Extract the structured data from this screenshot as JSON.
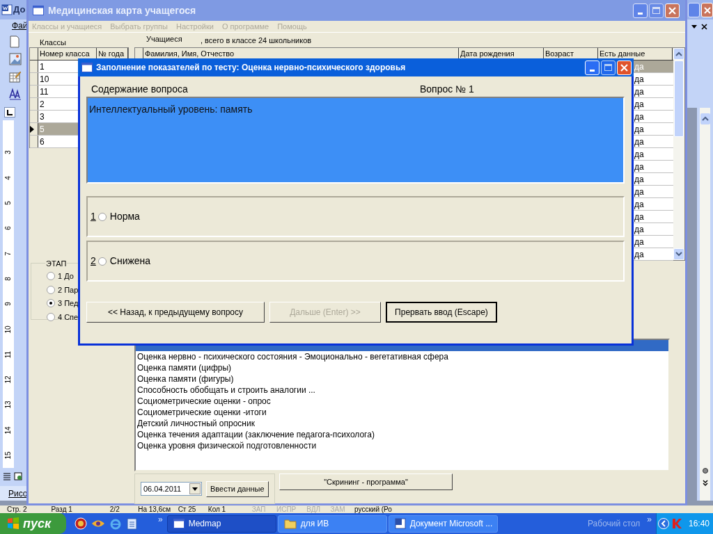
{
  "word_window": {
    "title": "До",
    "menu_item": "Фай",
    "ruler_numbers": [
      "3",
      "4",
      "5",
      "6",
      "7",
      "8",
      "9",
      "10",
      "11",
      "12",
      "13",
      "14",
      "15"
    ],
    "drawing_toolbar": "Рисо",
    "status_bar": [
      "Стр. 2",
      "Разд 1",
      "2/2",
      "На 13,6см",
      "Ст 25",
      "Кол 1",
      "ЗАП",
      "ИСПР",
      "ВДЛ",
      "ЗАМ",
      "русский (Ро"
    ]
  },
  "main_window": {
    "title": "Медицинская карта учащегося",
    "menu": [
      {
        "label": "Классы и учащиеся",
        "disabled": true
      },
      {
        "label": "Выбрать группы",
        "disabled": true
      },
      {
        "label": "Настройки",
        "disabled": true
      },
      {
        "label": "О программе",
        "disabled": true
      },
      {
        "label": "Помощь",
        "disabled": true
      }
    ],
    "classes_label": "Классы",
    "students_label": "Учащиеся",
    "students_summary": ", всего в классе 24 школьников",
    "classes_table": {
      "columns": [
        "Номер класса",
        "№ года"
      ],
      "rows": [
        {
          "number": "1",
          "selected": false
        },
        {
          "number": "10",
          "selected": false
        },
        {
          "number": "11",
          "selected": false
        },
        {
          "number": "2",
          "selected": false
        },
        {
          "number": "3",
          "selected": false
        },
        {
          "number": "5",
          "selected": true
        },
        {
          "number": "6",
          "selected": false
        }
      ]
    },
    "students_table": {
      "columns": [
        "Фамилия, Имя, Отчество",
        "Дата рождения",
        "Возраст",
        "Есть данные"
      ],
      "rows": [
        {
          "has_data": "да",
          "selected": true
        },
        {
          "has_data": "да",
          "selected": false
        },
        {
          "has_data": "да",
          "selected": false
        },
        {
          "has_data": "да",
          "selected": false
        },
        {
          "has_data": "да",
          "selected": false
        },
        {
          "has_data": "да",
          "selected": false
        },
        {
          "has_data": "да",
          "selected": false
        },
        {
          "has_data": "да",
          "selected": false
        },
        {
          "has_data": "да",
          "selected": false
        },
        {
          "has_data": "да",
          "selected": false
        },
        {
          "has_data": "да",
          "selected": false
        },
        {
          "has_data": "да",
          "selected": false
        },
        {
          "has_data": "да",
          "selected": false
        },
        {
          "has_data": "да",
          "selected": false
        },
        {
          "has_data": "да",
          "selected": false
        },
        {
          "has_data": "да",
          "selected": false
        }
      ]
    },
    "stage": {
      "title": "ЭТАП",
      "options": [
        {
          "label": "1 До",
          "selected": false
        },
        {
          "label": "2 Пар",
          "selected": false
        },
        {
          "label": "3 Пед",
          "selected": true
        },
        {
          "label": "4 Спе",
          "selected": false
        }
      ]
    },
    "tests": [
      {
        "selected": true
      },
      {
        "label": "Оценка нервно - психического состояния - Эмоционально - вегетативная сфера",
        "selected": false
      },
      {
        "label": "Оценка памяти (цифры)",
        "selected": false
      },
      {
        "label": "Оценка памяти (фигуры)",
        "selected": false
      },
      {
        "label": "Способность обобщать и строить аналогии ...",
        "selected": false
      },
      {
        "label": "Социометрические оценки - опрос",
        "selected": false
      },
      {
        "label": "Социометрические оценки -итоги",
        "selected": false
      },
      {
        "label": "Детский личностный опросник",
        "selected": false
      },
      {
        "label": "Оценка течения адаптации (заключение педагога-психолога)",
        "selected": false
      },
      {
        "label": "Оценка уровня физической подготовленности",
        "selected": false
      }
    ],
    "date": "06.04.2011",
    "enter_button": "Ввести данные",
    "screening_button": "\"Скрининг - программа\""
  },
  "dialog": {
    "title": "Заполнение показателей по тесту: Оценка нервно-психического здоровья",
    "question_caption": "Содержание вопроса",
    "question_number": "Вопрос № 1",
    "question": "Интеллектуальный уровень: память",
    "answers": [
      {
        "key": "1",
        "label": "Норма",
        "selected": false
      },
      {
        "key": "2",
        "label": "Снижена",
        "selected": false
      }
    ],
    "buttons": [
      {
        "label": "<< Назад, к предыдущему вопросу",
        "disabled": false,
        "focused": false
      },
      {
        "label": "Дальше (Enter) >>",
        "disabled": true,
        "focused": false
      },
      {
        "label": "Прервать ввод (Escape)",
        "disabled": false,
        "focused": true
      }
    ]
  },
  "taskbar": {
    "start": "пуск",
    "more": "»",
    "tasks": [
      {
        "label": "Medmap",
        "selected": true
      },
      {
        "label": "для ИВ",
        "selected": false
      },
      {
        "label": "Документ Microsoft ...",
        "selected": false
      }
    ],
    "desktop_toolbar": "Рабочий стол",
    "tray_more": "»",
    "clock": "16:40"
  }
}
